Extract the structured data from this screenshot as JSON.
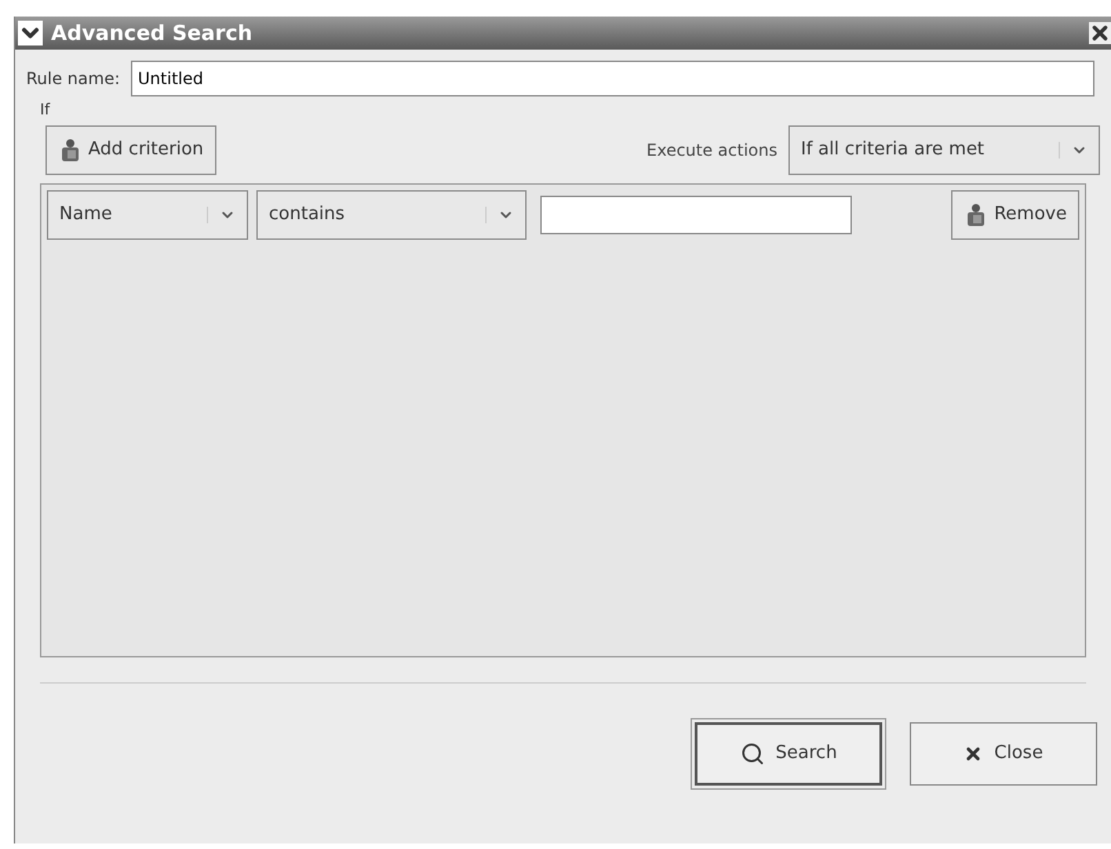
{
  "window": {
    "title": "Advanced Search"
  },
  "rule_name": {
    "label": "Rule name:",
    "value": "Untitled"
  },
  "conditions": {
    "label": "If",
    "add_button": "Add criterion",
    "execute_label": "Execute actions",
    "execute_value": "If all criteria are met",
    "criteria": [
      {
        "field": "Name",
        "operator": "contains",
        "remove_button": "Remove"
      }
    ]
  },
  "buttons": [
    {
      "kind": "search",
      "label": "Search",
      "default": true
    },
    {
      "kind": "close",
      "label": "Close",
      "default": false
    }
  ]
}
